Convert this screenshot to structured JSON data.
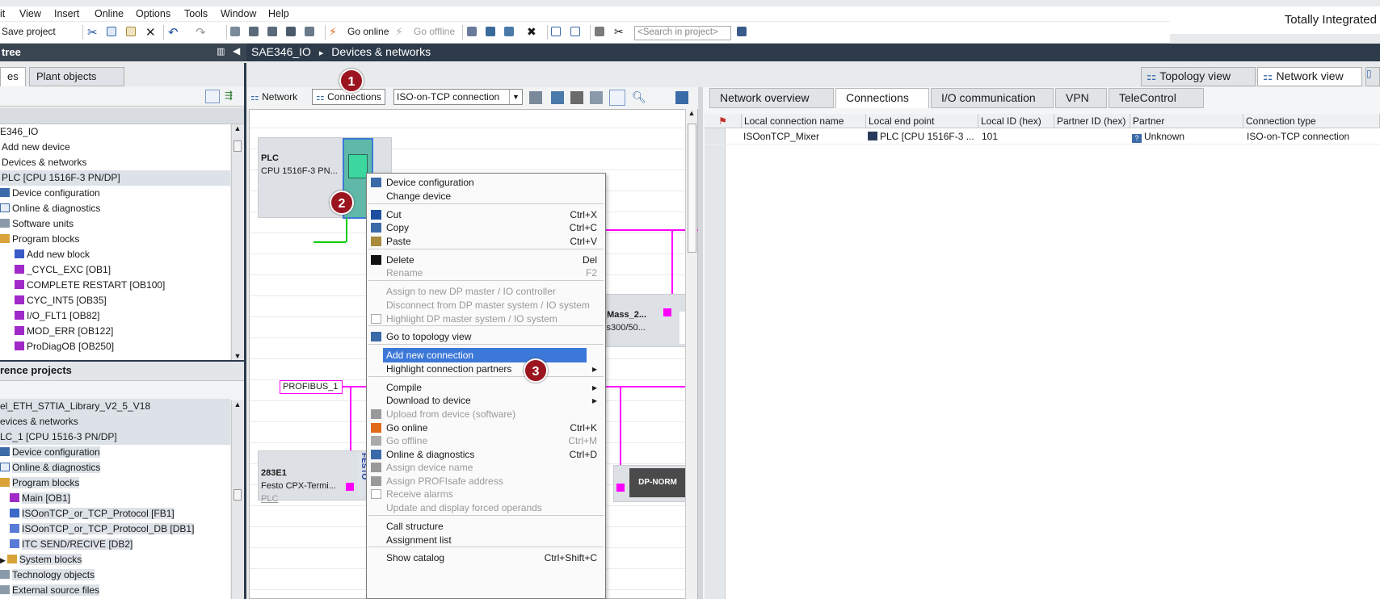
{
  "menu": [
    "it",
    "View",
    "Insert",
    "Online",
    "Options",
    "Tools",
    "Window",
    "Help"
  ],
  "brand": "Totally Integrated",
  "toolbar": {
    "save": "Save project",
    "go_online": "Go online",
    "go_offline": "Go offline",
    "search_placeholder": "<Search in project>"
  },
  "left": {
    "title": "tree",
    "tab_devices": "es",
    "tab_plant": "Plant objects",
    "tree": [
      "E346_IO",
      "Add new device",
      "Devices & networks",
      "PLC [CPU 1516F-3 PN/DP]",
      "Device configuration",
      "Online & diagnostics",
      "Software units",
      "Program blocks",
      "Add new block",
      "_CYCL_EXC [OB1]",
      "COMPLETE RESTART [OB100]",
      "CYC_INT5 [OB35]",
      "I/O_FLT1 [OB82]",
      "MOD_ERR [OB122]",
      "ProDiagOB [OB250]"
    ],
    "ref_title": "rence projects",
    "ref_tree": [
      "el_ETH_S7TIA_Library_V2_5_V18",
      "evices & networks",
      "LC_1 [CPU 1516-3 PN/DP]",
      "Device configuration",
      "Online & diagnostics",
      "Program blocks",
      "Main [OB1]",
      "ISOonTCP_or_TCP_Protocol [FB1]",
      "ISOonTCP_or_TCP_Protocol_DB [DB1]",
      "ITC SEND/RECIVE [DB2]",
      "System blocks",
      "Technology objects",
      "External source files"
    ]
  },
  "crumb": {
    "project": "SAE346_IO",
    "sep": "▸",
    "page": "Devices & networks"
  },
  "views": {
    "topology": "Topology view",
    "network": "Network view"
  },
  "net_toolbar": {
    "network": "Network",
    "connections": "Connections",
    "conn_type": "ISO-on-TCP connection"
  },
  "devices": {
    "plc_name": "PLC",
    "plc_cpu": "CPU 1516F-3 PN...",
    "mass_name": "_Mass_2...",
    "mass_type": "ss300/50...",
    "profibus": "PROFIBUS_1",
    "e283_name": "283E1",
    "e283_type": "Festo  CPX-Termi...",
    "e283_sub": "PLC",
    "festo": "FESTO",
    "dpnorm": "DP-NORM"
  },
  "context_menu": [
    {
      "label": "Device configuration",
      "shortcut": "",
      "disabled": false,
      "icon": "device-config-icon"
    },
    {
      "label": "Change device",
      "shortcut": "",
      "disabled": false,
      "icon": ""
    },
    {
      "label": "Cut",
      "shortcut": "Ctrl+X",
      "disabled": false,
      "icon": "cut-icon"
    },
    {
      "label": "Copy",
      "shortcut": "Ctrl+C",
      "disabled": false,
      "icon": "copy-icon"
    },
    {
      "label": "Paste",
      "shortcut": "Ctrl+V",
      "disabled": false,
      "icon": "paste-icon"
    },
    {
      "label": "Delete",
      "shortcut": "Del",
      "disabled": false,
      "icon": "delete-icon"
    },
    {
      "label": "Rename",
      "shortcut": "F2",
      "disabled": true,
      "icon": ""
    },
    {
      "label": "Assign to new DP master / IO controller",
      "shortcut": "",
      "disabled": true,
      "icon": ""
    },
    {
      "label": "Disconnect from DP master system / IO system",
      "shortcut": "",
      "disabled": true,
      "icon": ""
    },
    {
      "label": "Highlight DP master system / IO system",
      "shortcut": "",
      "disabled": true,
      "icon": "checkbox-icon"
    },
    {
      "label": "Go to topology view",
      "shortcut": "",
      "disabled": false,
      "icon": "topology-icon"
    },
    {
      "label": "Add new connection",
      "shortcut": "",
      "disabled": false,
      "icon": ""
    },
    {
      "label": "Highlight connection partners",
      "shortcut": "▸",
      "disabled": false,
      "icon": ""
    },
    {
      "label": "Compile",
      "shortcut": "▸",
      "disabled": false,
      "icon": ""
    },
    {
      "label": "Download to device",
      "shortcut": "▸",
      "disabled": false,
      "icon": ""
    },
    {
      "label": "Upload from device (software)",
      "shortcut": "",
      "disabled": true,
      "icon": "upload-icon"
    },
    {
      "label": "Go online",
      "shortcut": "Ctrl+K",
      "disabled": false,
      "icon": "go-online-icon"
    },
    {
      "label": "Go offline",
      "shortcut": "Ctrl+M",
      "disabled": true,
      "icon": "go-offline-icon"
    },
    {
      "label": "Online & diagnostics",
      "shortcut": "Ctrl+D",
      "disabled": false,
      "icon": "diagnostics-icon"
    },
    {
      "label": "Assign device name",
      "shortcut": "",
      "disabled": true,
      "icon": "assign-name-icon"
    },
    {
      "label": "Assign PROFIsafe address",
      "shortcut": "",
      "disabled": true,
      "icon": "profisafe-icon"
    },
    {
      "label": "Receive alarms",
      "shortcut": "",
      "disabled": true,
      "icon": "checkbox-icon"
    },
    {
      "label": "Update and display forced operands",
      "shortcut": "",
      "disabled": true,
      "icon": ""
    },
    {
      "label": "Call structure",
      "shortcut": "",
      "disabled": false,
      "icon": ""
    },
    {
      "label": "Assignment list",
      "shortcut": "",
      "disabled": false,
      "icon": ""
    },
    {
      "label": "Show catalog",
      "shortcut": "Ctrl+Shift+C",
      "disabled": false,
      "icon": ""
    }
  ],
  "badges": [
    "1",
    "2",
    "3"
  ],
  "right_tabs": [
    "Network overview",
    "Connections",
    "I/O communication",
    "VPN",
    "TeleControl"
  ],
  "grid": {
    "headers": [
      "Local connection name",
      "Local end point",
      "Local ID (hex)",
      "Partner ID (hex)",
      "Partner",
      "Connection type"
    ],
    "rows": [
      [
        "ISOonTCP_Mixer",
        "PLC [CPU 1516F-3 ...",
        "101",
        "",
        "Unknown",
        "ISO-on-TCP connection"
      ]
    ]
  },
  "colors": {
    "accent_selected": "#3c78d8",
    "profibus": "#ff00ff",
    "badge": "#9b1520",
    "ethernet": "#00cc00"
  }
}
